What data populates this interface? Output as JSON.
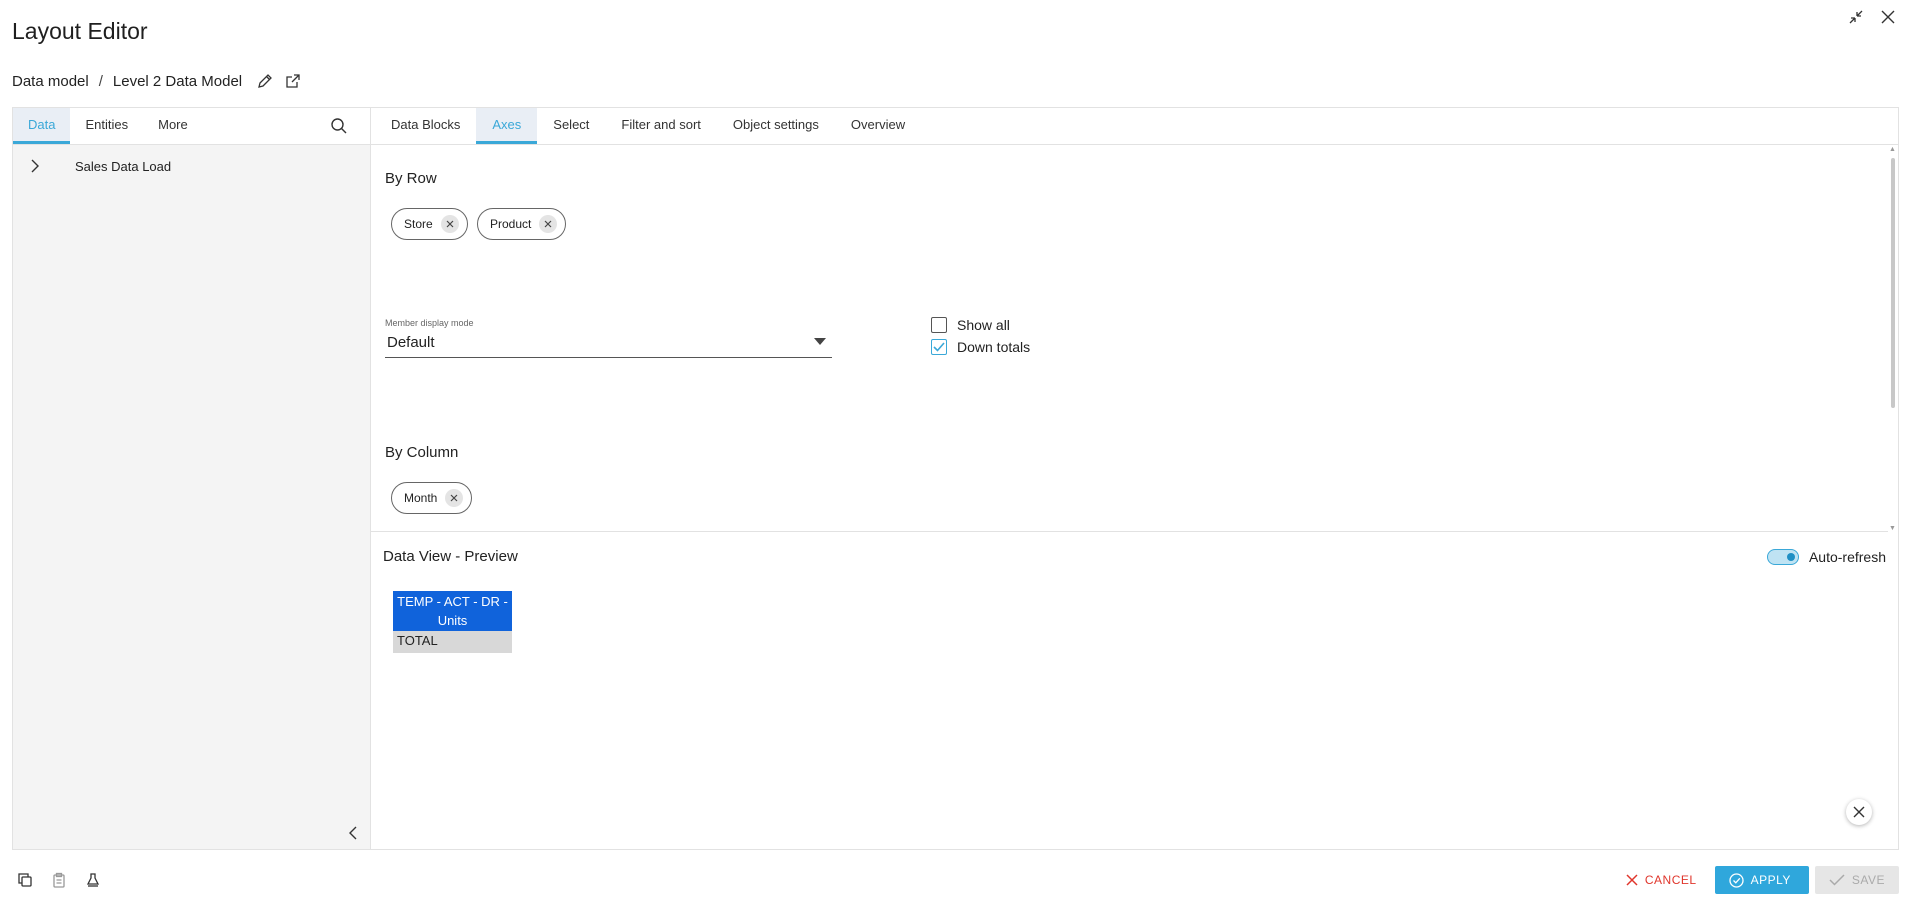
{
  "window": {
    "title": "Layout Editor",
    "icons": [
      "collapse-icon",
      "close-icon"
    ]
  },
  "breadcrumb": {
    "items": [
      "Data model",
      "Level 2 Data Model"
    ],
    "separator": "/",
    "icons": [
      "pencil-icon",
      "external-link-icon"
    ]
  },
  "left_panel": {
    "tabs": [
      {
        "label": "Data",
        "active": true
      },
      {
        "label": "Entities",
        "active": false
      },
      {
        "label": "More",
        "active": false
      }
    ],
    "tree": [
      {
        "label": "Sales Data Load",
        "expanded": false
      }
    ]
  },
  "right_panel": {
    "tabs": [
      {
        "label": "Data Blocks",
        "active": false
      },
      {
        "label": "Axes",
        "active": true
      },
      {
        "label": "Select",
        "active": false
      },
      {
        "label": "Filter and sort",
        "active": false
      },
      {
        "label": "Object settings",
        "active": false
      },
      {
        "label": "Overview",
        "active": false
      }
    ],
    "by_row": {
      "title": "By Row",
      "chips": [
        "Store",
        "Product"
      ]
    },
    "member_display_mode": {
      "label": "Member display mode",
      "value": "Default"
    },
    "show_all": {
      "label": "Show all",
      "checked": false
    },
    "down_totals": {
      "label": "Down totals",
      "checked": true
    },
    "by_column": {
      "title": "By Column",
      "chips": [
        "Month"
      ]
    }
  },
  "preview": {
    "title": "Data View - Preview",
    "auto_refresh": {
      "label": "Auto-refresh",
      "on": true
    },
    "table": {
      "header": "TEMP - ACT - DR - Units",
      "rows": [
        "TOTAL"
      ]
    }
  },
  "footer": {
    "left_icons": [
      "copy-icon",
      "paste-icon",
      "clear-format-icon"
    ],
    "cancel_label": "CANCEL",
    "apply_label": "APPLY",
    "save_label": "SAVE"
  },
  "colors": {
    "accent": "#3aa8d8",
    "apply_bg": "#2fa7dc",
    "cancel": "#e0362c",
    "preview_header": "#1063db"
  }
}
